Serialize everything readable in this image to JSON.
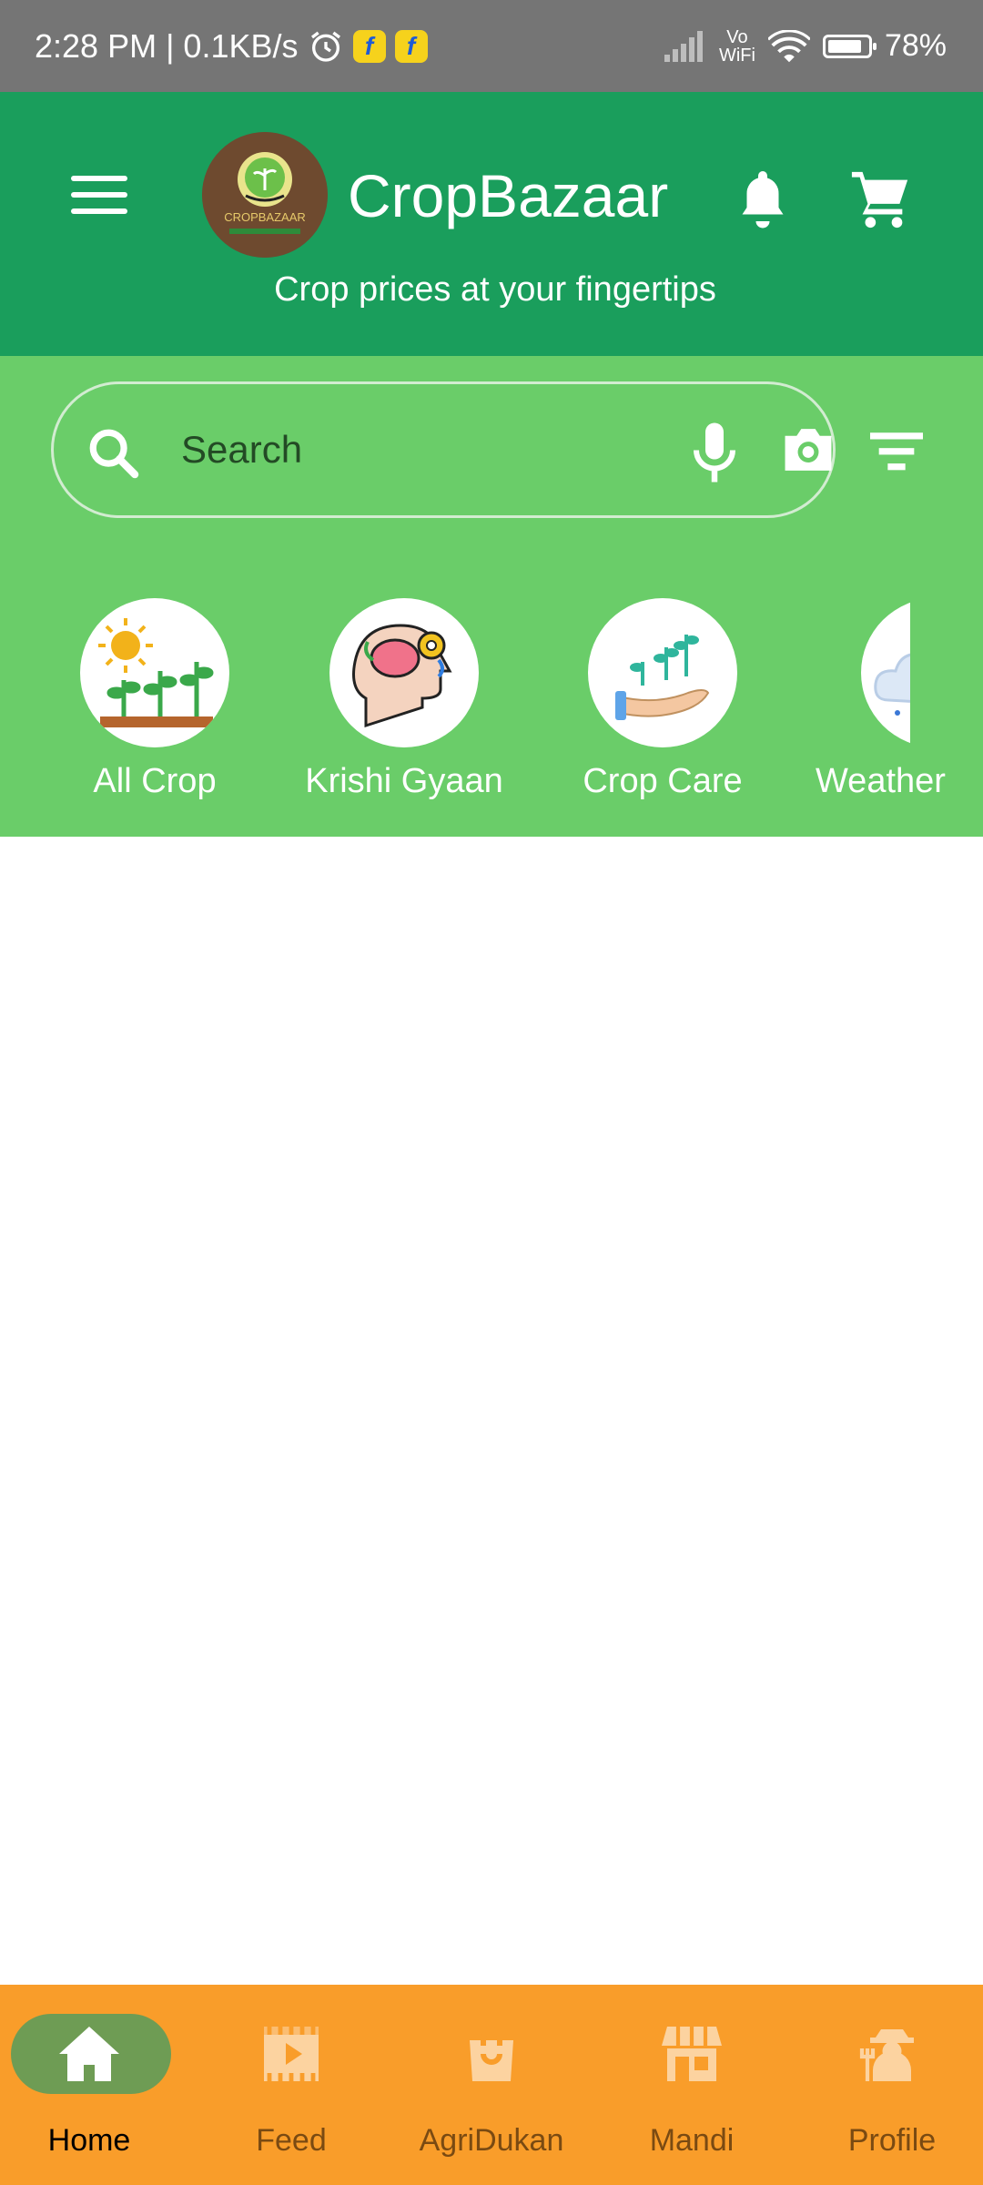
{
  "status_bar": {
    "time_speed": "2:28 PM | 0.1KB/s",
    "vowifi_top": "Vo",
    "vowifi_bottom": "WiFi",
    "battery": "78%"
  },
  "header": {
    "title": "CropBazaar",
    "tagline": "Crop prices at your fingertips",
    "logo_text": "CROPBAZAAR",
    "icons": [
      "menu-icon",
      "bell-icon",
      "cart-icon"
    ]
  },
  "search": {
    "placeholder": "Search",
    "icons": [
      "search-icon",
      "mic-icon",
      "camera-icon",
      "filter-icon"
    ]
  },
  "categories": [
    {
      "label": "All Crop"
    },
    {
      "label": "Krishi Gyaan"
    },
    {
      "label": "Crop Care"
    },
    {
      "label": "Weather"
    }
  ],
  "bottom_nav": {
    "items": [
      {
        "label": "Home",
        "icon": "home-icon",
        "active": true
      },
      {
        "label": "Feed",
        "icon": "video-icon",
        "active": false
      },
      {
        "label": "AgriDukan",
        "icon": "shopping-bag-icon",
        "active": false
      },
      {
        "label": "Mandi",
        "icon": "store-icon",
        "active": false
      },
      {
        "label": "Profile",
        "icon": "farmer-icon",
        "active": false
      }
    ]
  },
  "colors": {
    "status_bar": "#757575",
    "header": "#1a9e5c",
    "search_area": "#6acd69",
    "bottom_nav": "#f99d2a",
    "active_pill": "#6e9c54"
  }
}
